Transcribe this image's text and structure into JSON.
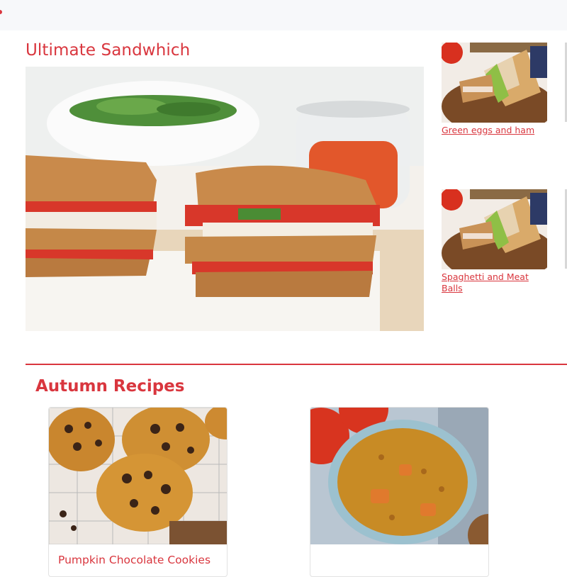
{
  "hero": {
    "title": "Ultimate Sandwhich"
  },
  "sidebar_recipes": [
    {
      "label": "Green eggs and ham"
    },
    {
      "label": "Spaghetti and Meat Balls"
    }
  ],
  "autumn": {
    "title": "Autumn Recipes",
    "cards": [
      {
        "label": "Pumpkin Chocolate Cookies"
      },
      {
        "label": ""
      }
    ]
  },
  "colors": {
    "accent": "#d9363e",
    "topbar": "#f7f8fa"
  }
}
